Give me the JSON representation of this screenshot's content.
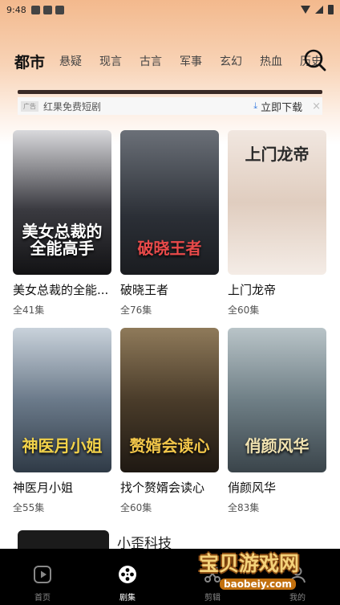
{
  "status_bar": {
    "time": "9:48"
  },
  "tabs": [
    {
      "label": "都市",
      "active": true
    },
    {
      "label": "悬疑"
    },
    {
      "label": "现言"
    },
    {
      "label": "古言"
    },
    {
      "label": "军事"
    },
    {
      "label": "玄幻"
    },
    {
      "label": "热血"
    },
    {
      "label": "历史"
    }
  ],
  "ad": {
    "badge": "广告",
    "text": "红果免费短剧",
    "download_label": "立即下载",
    "close_label": "×"
  },
  "dramas": [
    {
      "name": "美女总裁的全能...",
      "episodes": "全41集",
      "poster_text": "美女总裁的全能高手",
      "bg": "#2a2a2e"
    },
    {
      "name": "破晓王者",
      "episodes": "全76集",
      "poster_text": "破晓王者",
      "bg": "#3b4048"
    },
    {
      "name": "上门龙帝",
      "episodes": "全60集",
      "poster_text": "上门龙帝",
      "bg": "#e9d9cf"
    },
    {
      "name": "神医月小姐",
      "episodes": "全55集",
      "poster_text": "神医月小姐",
      "bg": "#586473"
    },
    {
      "name": "找个赘婿会读心",
      "episodes": "全60集",
      "poster_text": "赘婿会读心",
      "bg": "#4a4030"
    },
    {
      "name": "俏颜风华",
      "episodes": "全83集",
      "poster_text": "俏颜风华",
      "bg": "#6a7a82"
    }
  ],
  "partial_item": {
    "text": "小歪科技"
  },
  "bottom_nav": [
    {
      "label": "首页",
      "icon": "play-icon"
    },
    {
      "label": "剧集",
      "icon": "film-reel-icon",
      "active": true
    },
    {
      "label": "剪辑",
      "icon": "scissors-icon"
    },
    {
      "label": "我的",
      "icon": "user-icon"
    }
  ],
  "watermark": {
    "title": "宝贝游戏网",
    "url": "baobeiy.com"
  }
}
